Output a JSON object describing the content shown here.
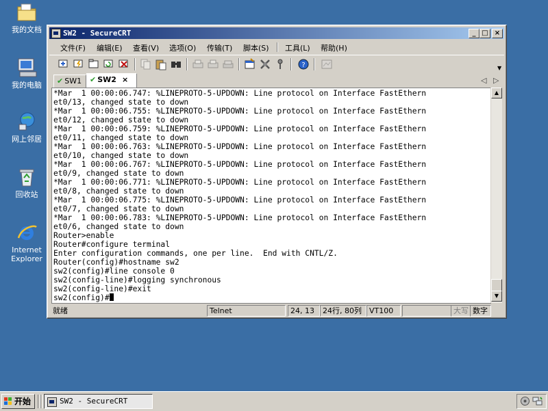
{
  "desktop": {
    "icons": [
      {
        "label": "我的文档",
        "icon": "my-documents-icon"
      },
      {
        "label": "我的电脑",
        "icon": "my-computer-icon"
      },
      {
        "label": "网上邻居",
        "icon": "network-places-icon"
      },
      {
        "label": "回收站",
        "icon": "recycle-bin-icon"
      },
      {
        "label": "Internet Explorer",
        "icon": "internet-explorer-icon"
      }
    ]
  },
  "window": {
    "title": "SW2 - SecureCRT",
    "controls": {
      "minimize": "_",
      "maximize": "□",
      "close": "×"
    },
    "menu": [
      {
        "label": "文件(F)"
      },
      {
        "label": "编辑(E)"
      },
      {
        "label": "查看(V)"
      },
      {
        "label": "选项(O)"
      },
      {
        "label": "传输(T)"
      },
      {
        "label": "脚本(S)"
      },
      {
        "label": "工具(L)"
      },
      {
        "label": "帮助(H)"
      }
    ],
    "toolbar": [
      "connect-icon",
      "quick-connect-icon",
      "connect-tab-icon",
      "reconnect-icon",
      "disconnect-icon",
      "copy-icon",
      "paste-icon",
      "find-icon",
      "print-icon",
      "print-selection-icon",
      "printer-setup-icon",
      "session-options-icon",
      "global-options-icon",
      "keymap-icon",
      "help-icon",
      "map-icon"
    ],
    "tabs": [
      {
        "label": "SW1",
        "active": false
      },
      {
        "label": "SW2",
        "active": true,
        "close": "×"
      }
    ],
    "tab_nav": {
      "prev": "◁",
      "next": "▷"
    },
    "terminal_lines": [
      "*Mar  1 00:00:06.747: %LINEPROTO-5-UPDOWN: Line protocol on Interface FastEthern",
      "et0/13, changed state to down",
      "*Mar  1 00:00:06.755: %LINEPROTO-5-UPDOWN: Line protocol on Interface FastEthern",
      "et0/12, changed state to down",
      "*Mar  1 00:00:06.759: %LINEPROTO-5-UPDOWN: Line protocol on Interface FastEthern",
      "et0/11, changed state to down",
      "*Mar  1 00:00:06.763: %LINEPROTO-5-UPDOWN: Line protocol on Interface FastEthern",
      "et0/10, changed state to down",
      "*Mar  1 00:00:06.767: %LINEPROTO-5-UPDOWN: Line protocol on Interface FastEthern",
      "et0/9, changed state to down",
      "*Mar  1 00:00:06.771: %LINEPROTO-5-UPDOWN: Line protocol on Interface FastEthern",
      "et0/8, changed state to down",
      "*Mar  1 00:00:06.775: %LINEPROTO-5-UPDOWN: Line protocol on Interface FastEthern",
      "et0/7, changed state to down",
      "*Mar  1 00:00:06.783: %LINEPROTO-5-UPDOWN: Line protocol on Interface FastEthern",
      "et0/6, changed state to down",
      "Router>enable",
      "Router#configure terminal",
      "Enter configuration commands, one per line.  End with CNTL/Z.",
      "Router(config)#hostname sw2",
      "sw2(config)#line console 0",
      "sw2(config-line)#logging synchronous",
      "sw2(config-line)#exit",
      "sw2(config)#"
    ],
    "status": {
      "ready": "就绪",
      "protocol": "Telnet",
      "cursor_pos": "24, 13",
      "dims": "24行, 80列",
      "emulation": "VT100",
      "caps": "大写",
      "num": "数字"
    }
  },
  "taskbar": {
    "start_label": "开始",
    "task_label": "SW2 - SecureCRT"
  }
}
